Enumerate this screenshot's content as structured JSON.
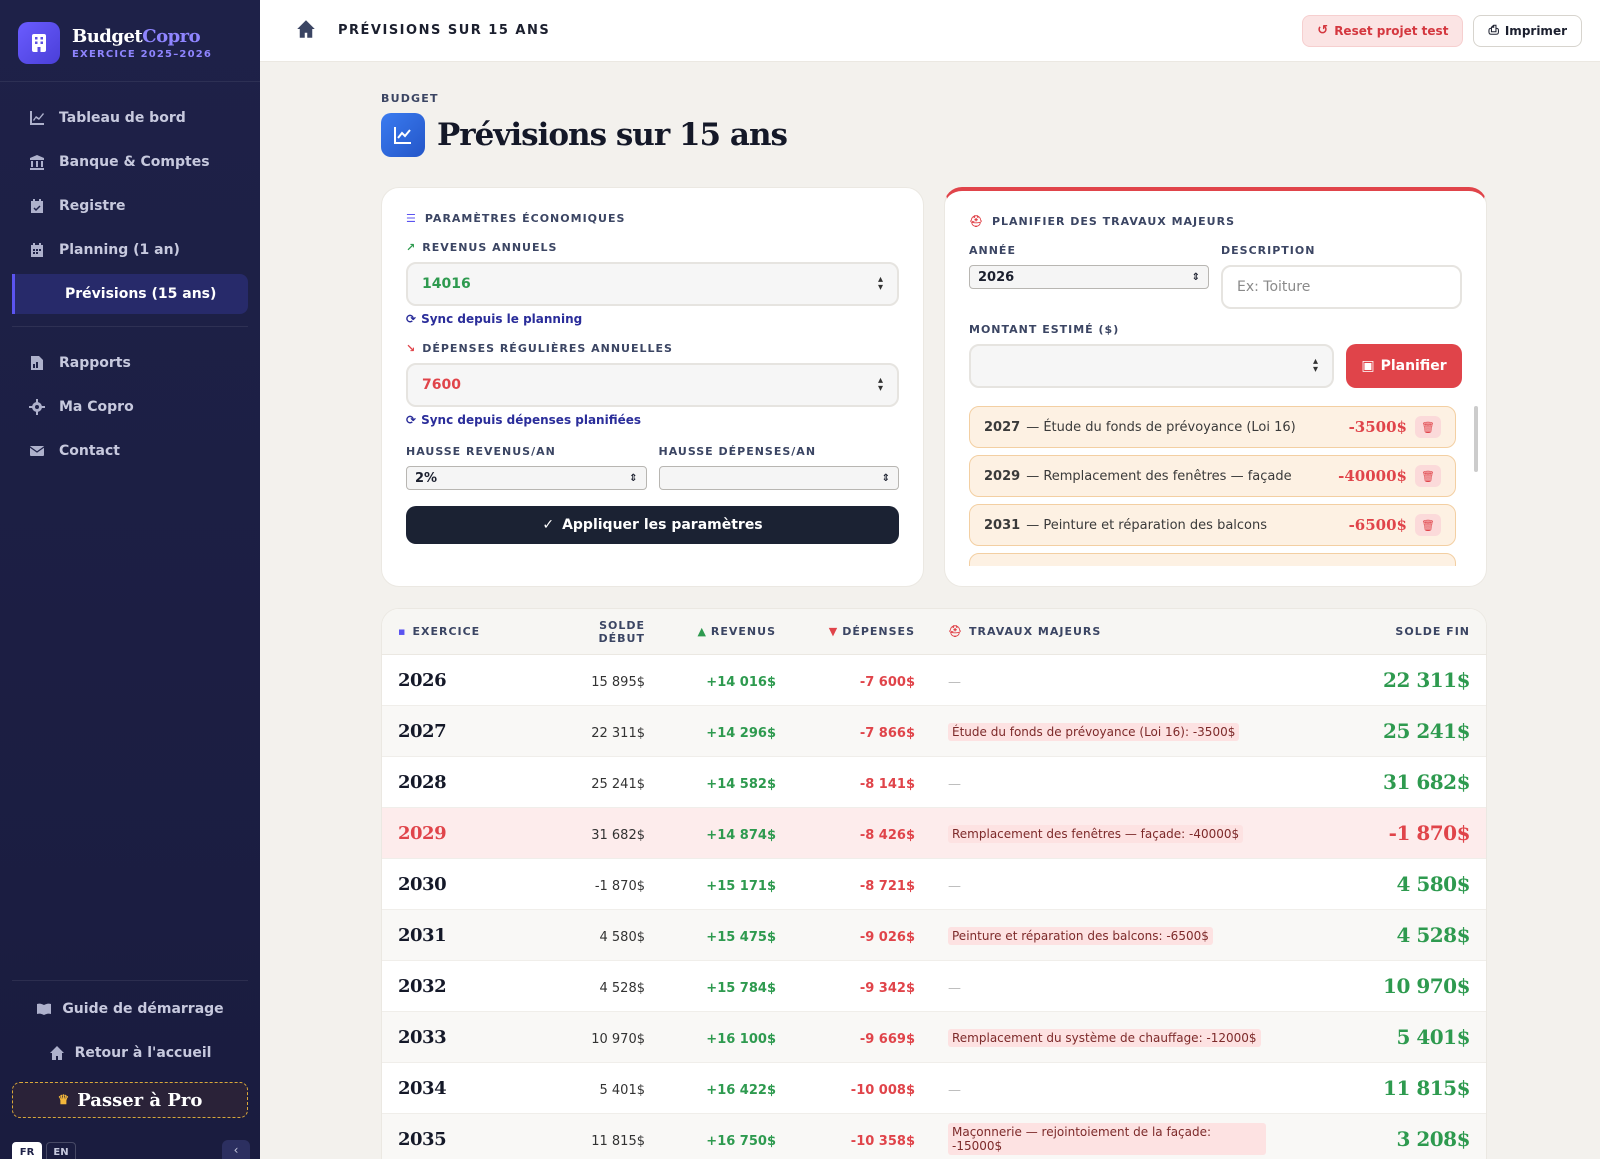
{
  "brand": {
    "name_a": "Budget",
    "name_b": "Copro",
    "subtitle": "EXERCICE 2025–2026"
  },
  "nav": {
    "items": [
      {
        "label": "Tableau de bord",
        "icon": "chart-line-icon"
      },
      {
        "label": "Banque & Comptes",
        "icon": "bank-icon"
      },
      {
        "label": "Registre",
        "icon": "calendar-check-icon"
      },
      {
        "label": "Planning (1 an)",
        "icon": "calendar-icon"
      },
      {
        "label": "Prévisions (15 ans)",
        "icon": "",
        "active": true
      }
    ],
    "items2": [
      {
        "label": "Rapports",
        "icon": "file-report-icon"
      },
      {
        "label": "Ma Copro",
        "icon": "gear-icon"
      },
      {
        "label": "Contact",
        "icon": "envelope-icon"
      }
    ],
    "guide": "Guide de démarrage",
    "home": "Retour à l'accueil",
    "pro": "Passer à Pro",
    "lang_fr": "FR",
    "lang_en": "EN"
  },
  "topbar": {
    "breadcrumb": "PRÉVISIONS SUR 15 ANS",
    "reset": "Reset projet test",
    "print": "Imprimer"
  },
  "page": {
    "eyebrow": "BUDGET",
    "title": "Prévisions sur 15 ans"
  },
  "params": {
    "section": "PARAMÈTRES ÉCONOMIQUES",
    "revenus_label": "REVENUS ANNUELS",
    "revenus_value": "14016",
    "sync_planning": "Sync depuis le planning",
    "depenses_label": "DÉPENSES RÉGULIÈRES ANNUELLES",
    "depenses_value": "7600",
    "sync_depenses": "Sync depuis dépenses planifiées",
    "hausse_rev_label": "HAUSSE REVENUS/AN",
    "hausse_rev_value": "2%",
    "hausse_dep_label": "HAUSSE DÉPENSES/AN",
    "hausse_dep_value": "",
    "apply": "Appliquer les paramètres"
  },
  "travaux": {
    "section": "PLANIFIER DES TRAVAUX MAJEURS",
    "annee_label": "ANNÉE",
    "annee_value": "2026",
    "desc_label": "DESCRIPTION",
    "desc_placeholder": "Ex: Toiture",
    "montant_label": "MONTANT ESTIMÉ ($)",
    "planifier": "Planifier",
    "items": [
      {
        "year": "2027",
        "desc": "— Étude du fonds de prévoyance (Loi 16)",
        "amount": "-3500$"
      },
      {
        "year": "2029",
        "desc": "— Remplacement des fenêtres — façade",
        "amount": "-40000$"
      },
      {
        "year": "2031",
        "desc": "— Peinture et réparation des balcons",
        "amount": "-6500$"
      },
      {
        "year": "",
        "desc": "",
        "amount": ""
      }
    ]
  },
  "table": {
    "headers": {
      "exercice": "EXERCICE",
      "solde_debut": "SOLDE DÉBUT",
      "revenus": "REVENUS",
      "depenses": "DÉPENSES",
      "travaux": "TRAVAUX MAJEURS",
      "solde_fin": "SOLDE FIN"
    },
    "rows": [
      {
        "year": "2026",
        "debut": "15 895$",
        "rev": "+14 016$",
        "dep": "-7 600$",
        "trav": "—",
        "fin": "22 311$",
        "neg": false
      },
      {
        "year": "2027",
        "debut": "22 311$",
        "rev": "+14 296$",
        "dep": "-7 866$",
        "trav": "Étude du fonds de prévoyance (Loi 16): -3500$",
        "fin": "25 241$",
        "neg": false
      },
      {
        "year": "2028",
        "debut": "25 241$",
        "rev": "+14 582$",
        "dep": "-8 141$",
        "trav": "—",
        "fin": "31 682$",
        "neg": false
      },
      {
        "year": "2029",
        "debut": "31 682$",
        "rev": "+14 874$",
        "dep": "-8 426$",
        "trav": "Remplacement des fenêtres — façade: -40000$",
        "fin": "-1 870$",
        "neg": true
      },
      {
        "year": "2030",
        "debut": "-1 870$",
        "rev": "+15 171$",
        "dep": "-8 721$",
        "trav": "—",
        "fin": "4 580$",
        "neg": false
      },
      {
        "year": "2031",
        "debut": "4 580$",
        "rev": "+15 475$",
        "dep": "-9 026$",
        "trav": "Peinture et réparation des balcons: -6500$",
        "fin": "4 528$",
        "neg": false
      },
      {
        "year": "2032",
        "debut": "4 528$",
        "rev": "+15 784$",
        "dep": "-9 342$",
        "trav": "—",
        "fin": "10 970$",
        "neg": false
      },
      {
        "year": "2033",
        "debut": "10 970$",
        "rev": "+16 100$",
        "dep": "-9 669$",
        "trav": "Remplacement du système de chauffage: -12000$",
        "fin": "5 401$",
        "neg": false
      },
      {
        "year": "2034",
        "debut": "5 401$",
        "rev": "+16 422$",
        "dep": "-10 008$",
        "trav": "—",
        "fin": "11 815$",
        "neg": false
      },
      {
        "year": "2035",
        "debut": "11 815$",
        "rev": "+16 750$",
        "dep": "-10 358$",
        "trav": "Maçonnerie — rejointoiement de la façade: -15000$",
        "fin": "3 208$",
        "neg": false
      }
    ]
  }
}
